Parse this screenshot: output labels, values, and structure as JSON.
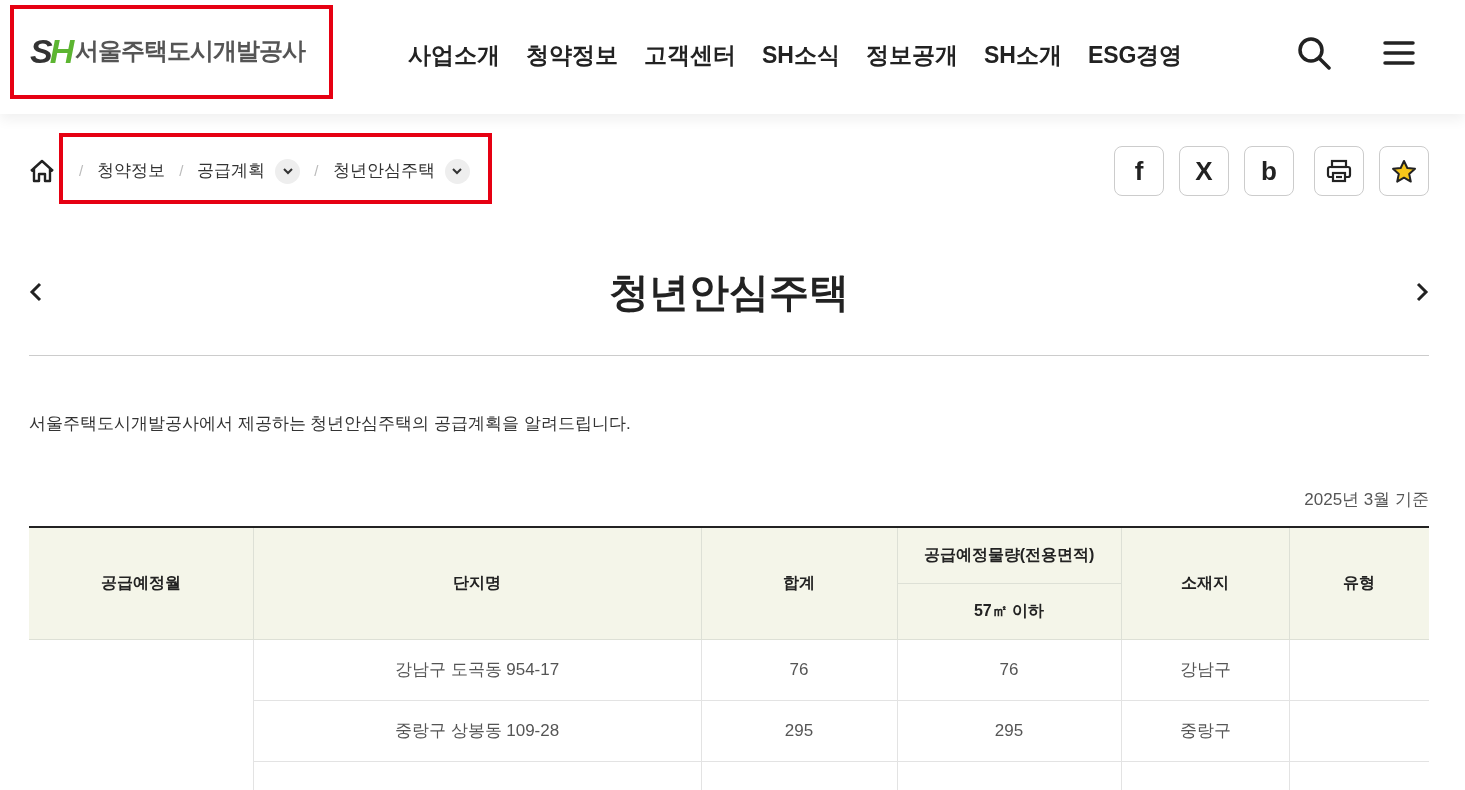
{
  "header": {
    "logo": {
      "mark": "SH",
      "text": "서울주택도시개발공사"
    },
    "nav": [
      "사업소개",
      "청약정보",
      "고객센터",
      "SH소식",
      "정보공개",
      "SH소개",
      "ESG경영"
    ]
  },
  "breadcrumb": [
    {
      "separator": "/",
      "label": "청약정보",
      "has_dropdown": false
    },
    {
      "separator": "/",
      "label": "공급계획",
      "has_dropdown": true
    },
    {
      "separator": "/",
      "label": "청년안심주택",
      "has_dropdown": true
    }
  ],
  "share_buttons": [
    {
      "kind": "text",
      "glyph": "f"
    },
    {
      "kind": "text",
      "glyph": "X"
    },
    {
      "kind": "text",
      "glyph": "b"
    },
    {
      "kind": "print"
    },
    {
      "kind": "star"
    }
  ],
  "page_title": "청년안심주택",
  "description": "서울주택도시개발공사에서 제공하는 청년안심주택의 공급계획을 알려드립니다.",
  "table": {
    "note": "2025년 3월 기준",
    "columns": [
      "공급예정월",
      "단지명",
      "합계",
      "공급예정물량(전용면적)",
      "소재지",
      "유형"
    ],
    "subcolumns": [
      "57㎡ 이하"
    ],
    "rows": [
      [
        "",
        "강남구 도곡동 954-17",
        "76",
        "76",
        "강남구",
        ""
      ],
      [
        "",
        "중랑구 상봉동 109-28",
        "295",
        "295",
        "중랑구",
        ""
      ]
    ]
  }
}
